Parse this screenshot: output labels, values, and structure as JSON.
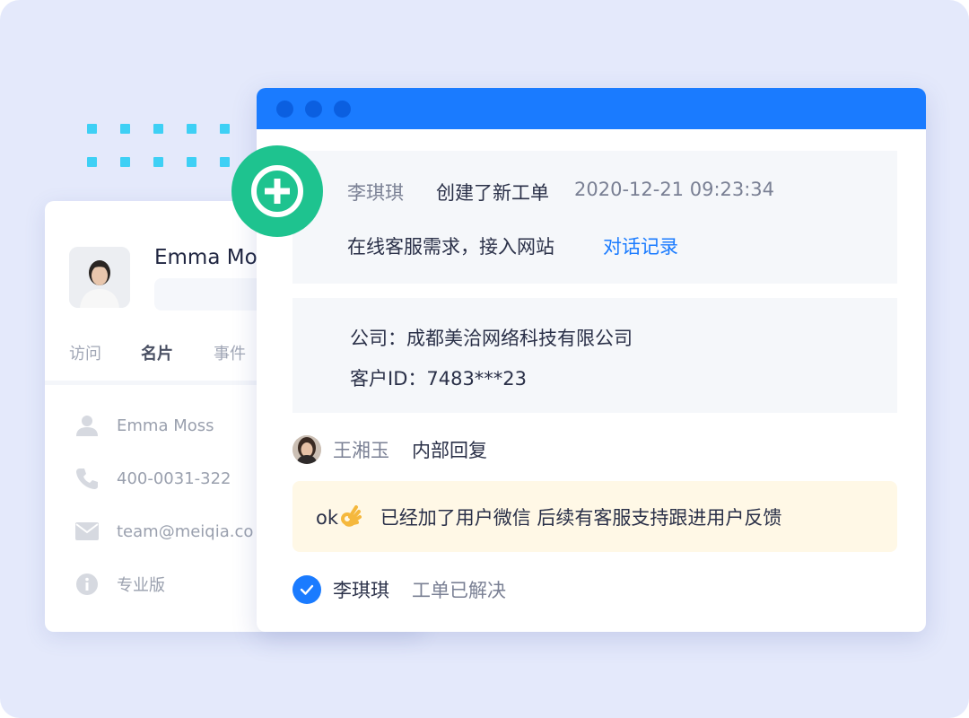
{
  "contact_card": {
    "name": "Emma Mo",
    "tabs": [
      "访问",
      "名片",
      "事件"
    ],
    "active_tab": "名片",
    "info": {
      "name": "Emma Moss",
      "phone": "400-0031-322",
      "email": "team@meiqia.co",
      "plan": "专业版"
    }
  },
  "ticket": {
    "creator": "李琪琪",
    "action": "创建了新工单",
    "timestamp": "2020-12-21 09:23:34",
    "description": "在线客服需求，接入网站",
    "link_text": "对话记录",
    "company": "公司：成都美洽网络科技有限公司",
    "customer_id": "客户ID：7483***23",
    "reply": {
      "author": "王湘玉",
      "type": "内部回复",
      "message_prefix": "ok",
      "message": "已经加了用户微信 后续有客服支持跟进用户反馈"
    },
    "resolution": {
      "author": "李琪琪",
      "status": "工单已解决"
    }
  },
  "colors": {
    "accent": "#1a7bff",
    "badge": "#1ec38f",
    "background": "#e4e9fb",
    "note": "#fff8e6",
    "dots": "#3ed0f5"
  },
  "icons": [
    "plus-icon",
    "user-icon",
    "phone-icon",
    "mail-icon",
    "info-icon",
    "check-icon",
    "ok-hand-emoji"
  ]
}
